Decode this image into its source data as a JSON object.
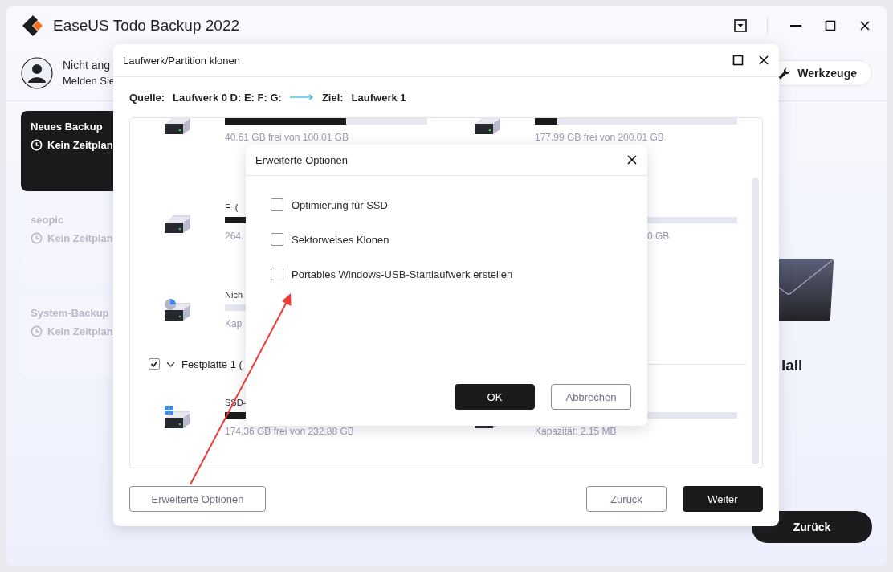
{
  "app": {
    "title": "EaseUS Todo Backup 2022"
  },
  "user": {
    "line_1": "Nicht ang",
    "line_2": "Melden Sie"
  },
  "tools_button": {
    "label": "Werkzeuge"
  },
  "backups": [
    {
      "name": "Neues Backup",
      "schedule": "Kein Zeitplan",
      "selected": true
    },
    {
      "name": "seopic",
      "schedule": "Kein Zeitplan",
      "selected": false
    },
    {
      "name": "System-Backup",
      "schedule": "Kein Zeitplan",
      "selected": false
    }
  ],
  "tile": {
    "label": "lail"
  },
  "back_button": {
    "label": "Zurück"
  },
  "clone_dialog": {
    "title": "Laufwerk/Partition klonen",
    "source_label": "Quelle:",
    "source": "Laufwerk 0 D: E: F: G:",
    "target_label": "Ziel:",
    "target": "Laufwerk 1",
    "items": [
      {
        "kind": "row",
        "cells": [
          {
            "kind": "drive",
            "level": 0.6,
            "info": "40.61 GB frei von 100.01 GB"
          },
          {
            "kind": "drive",
            "level": 0.11,
            "info": "177.99 GB frei von 200.01 GB"
          }
        ]
      },
      {
        "kind": "row",
        "cells": [
          {
            "kind": "drive",
            "name": "F: (",
            "level": 0.3,
            "info": "264."
          },
          {
            "kind": "covered",
            "info": "0 GB"
          }
        ]
      },
      {
        "kind": "row",
        "cells": [
          {
            "kind": "unallocated",
            "name": "Nich",
            "info": "Kap"
          }
        ]
      },
      {
        "kind": "group",
        "label": "Festplatte 1 (",
        "checked": true,
        "expanded": true
      },
      {
        "kind": "row",
        "cells": [
          {
            "kind": "system",
            "name": "SSD-",
            "level": 0.3,
            "info": "174.36 GB frei von 232.88 GB"
          },
          {
            "kind": "drive",
            "info": "Kapazität: 2.15 MB"
          }
        ]
      }
    ],
    "advanced_button": "Erweiterte Optionen",
    "back_button": "Zurück",
    "next_button": "Weiter"
  },
  "options_dialog": {
    "title": "Erweiterte Optionen",
    "options": [
      {
        "label": "Optimierung für SSD",
        "checked": false
      },
      {
        "label": "Sektorweises Klonen",
        "checked": false
      },
      {
        "label": "Portables Windows-USB-Startlaufwerk erstellen",
        "checked": false
      }
    ],
    "ok_button": "OK",
    "cancel_button": "Abbrechen"
  }
}
